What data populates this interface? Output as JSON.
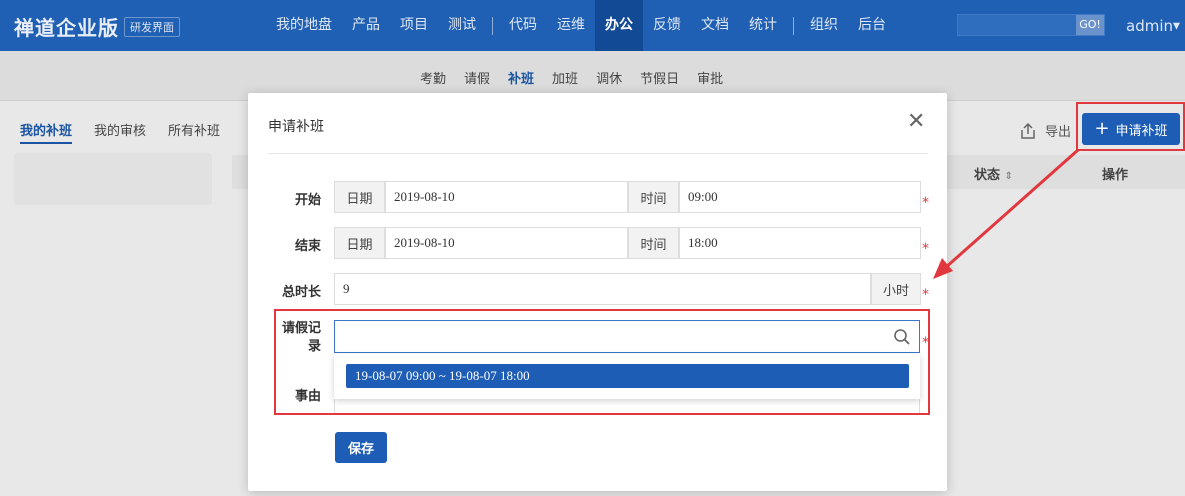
{
  "app": {
    "brand": "禅道企业版",
    "badge": "研发界面",
    "user": "admin"
  },
  "nav": {
    "items_left": [
      "我的地盘",
      "产品",
      "项目",
      "测试"
    ],
    "items_mid": [
      "代码",
      "运维",
      "办公",
      "反馈",
      "文档",
      "统计"
    ],
    "items_right": [
      "组织",
      "后台"
    ],
    "active": "办公",
    "search_go": "GO!"
  },
  "subnav": {
    "items": [
      "考勤",
      "请假",
      "补班",
      "加班",
      "调休",
      "节假日",
      "审批"
    ],
    "active": "补班"
  },
  "tabs": {
    "items": [
      "我的补班",
      "我的审核",
      "所有补班"
    ],
    "active": "我的补班"
  },
  "toolbar": {
    "export_label": "导出",
    "apply_label": "申请补班"
  },
  "table": {
    "status_header": "状态",
    "ops_header": "操作"
  },
  "dialog": {
    "title": "申请补班",
    "start": {
      "label": "开始",
      "date_addon": "日期",
      "date": "2019-08-10",
      "time_addon": "时间",
      "time": "09:00"
    },
    "end": {
      "label": "结束",
      "date_addon": "日期",
      "date": "2019-08-10",
      "time_addon": "时间",
      "time": "18:00"
    },
    "duration": {
      "label": "总时长",
      "value": "9",
      "unit": "小时"
    },
    "leave_record": {
      "label_line1": "请假记",
      "label_line2": "录",
      "value": "",
      "options": [
        "19-08-07 09:00 ~ 19-08-07 18:00"
      ]
    },
    "reason": {
      "label": "事由"
    },
    "save_label": "保存"
  },
  "colors": {
    "primary": "#1e5db5",
    "topbar": "#1f5fb4",
    "highlight": "#e0383e"
  }
}
